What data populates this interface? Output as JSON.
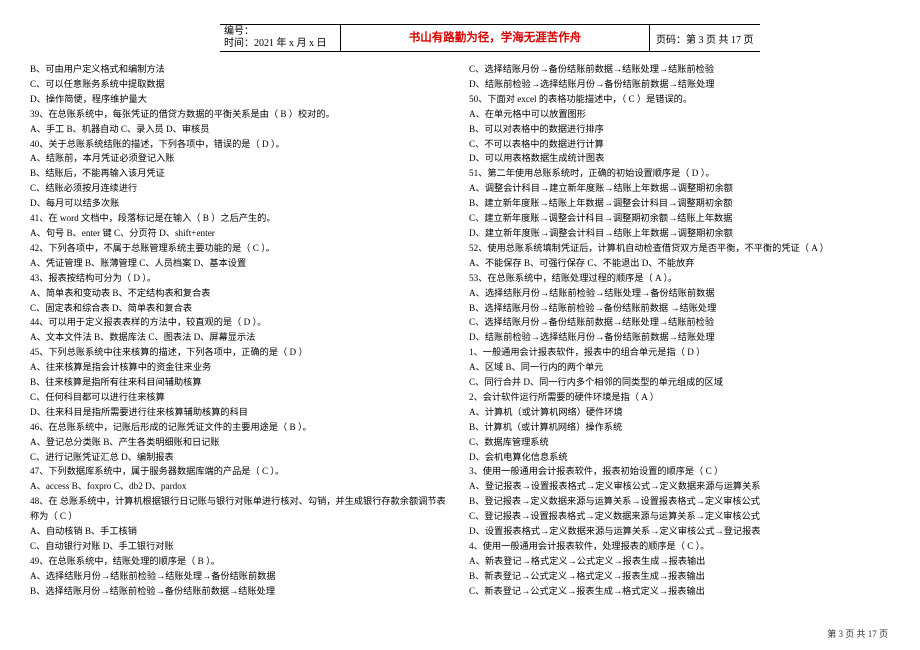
{
  "header": {
    "id_label": "编号：",
    "time_label": "时间：2021 年 x 月 x 日",
    "motto": "书山有路勤为径，学海无涯苦作舟",
    "page_label": "页码：第 3 页 共 17 页"
  },
  "footer": "第 3 页 共 17 页",
  "left_lines": [
    "B、可由用户定义格式和编制方法",
    "C、可以任意账务系统中提取数据",
    "D、操作简便，程序维护量大",
    "39、在总账系统中，每张凭证的借贷方数据的平衡关系是由（ B ）校对的。",
    "A、手工    B、机器自动    C、录入员    D、审核员",
    "40、关于总账系统结账的描述，下列各项中，错误的是（ D     ）。",
    "A、结账前，本月凭证必须登记入账",
    "B、结账后，不能再输入该月凭证",
    "C、结账必须按月连续进行",
    "D、每月可以结多次账",
    "41、在 word 文档中，段落标记是在输入（  B  ）之后产生的。",
    "A、句号    B、enter 键    C、分页符    D、shift+enter",
    "42、下列各项中，不属于总账管理系统主要功能的是（  C   ）。",
    "A、凭证管理   B、账薄管理    C、人员档案    D、基本设置",
    "43、报表按结构可分为（ D   ）。",
    "A、简单表和变动表    B、不定结构表和复合表",
    "C、固定表和综合表    D、简单表和复合表",
    "44、可以用于定义报表表样的方法中，较直观的是（ D ）。",
    "A、文本文件法    B、数据库法    C、图表法    D、屏幕显示法",
    "45、下列总账系统中往来核算的描述，下列各项中，正确的是（  D    ）",
    "A、往来核算是指会计核算中的资金往来业务",
    "B、往来核算是指所有往来科目间辅助核算",
    "C、任何科目都可以进行往来核算",
    "D、往来科目是指所需要进行往来核算辅助核算的科目",
    "46、在总账系统中，记账后形成的记账凭证文件的主要用途是（ B ）。",
    "A、登记总分类账    B、产生各类明细账和日记账",
    "C、进行记账凭证汇总 D、编制报表",
    "47、下列数据库系统中，属于服务器数据库端的产品是（  C    ）。",
    "A、access    B、foxpro    C、db2    D、pardox",
    "48、在 总账系统中，计算机根据银行日记账与银行对账单进行核对、勾销，并生成银行存款余额调节表",
    "称为（ C  ）",
    "A、自动核销       B、手工核销",
    "C、自动银行对账   D、手工银行对账",
    "49、在总账系统中，结账处理的顺序是（ B    ）。",
    "A、选择结账月份→结账前检验→结账处理→备份结账前数据",
    "B、选择结账月份→结账前检验→备份结账前数据→结账处理"
  ],
  "right_lines": [
    "C、选择结账月份→备份结账前数据→结账处理→结账前检验",
    "D、结账前检验→选择结账月份→备份结账前数据→结账处理",
    "50、下面对 excel 的表格功能描述中，（  C  ）是错误的。",
    "A、在单元格中可以放置图形",
    "B、可以对表格中的数据进行排序",
    "C、不可以表格中的数据进行计算",
    "D、可以用表格数据生成统计图表",
    "51、第二年使用总账系统时，正确的初始设置顺序是（ D    ）。",
    "A、调整会计科目→建立新年度账→结账上年数据→调整期初余额",
    "B、建立新年度账→结账上年数据→调整会计科目→调整期初余额",
    "C、建立新年度账→调整会计科目→调整期初余额→结账上年数据",
    "D、建立新年度账→调整会计科目→结账上年数据→调整期初余额",
    "52、使用总账系统填制凭证后，计算机自动检查借贷双方是否平衡，不平衡的凭证（ A ）",
    "A、不能保存    B、可强行保存    C、不能退出    D、不能放弃",
    "53、在总账系统中，结账处理过程的顺序是（ A  ）。",
    "A、选择结账月份→结账前检验→结账处理→备份结账前数据",
    "B、选择结账月份→结账前检验→备份结账前数据 →结账处理",
    "C、选择结账月份→备份结账前数据→结账处理→结账前检验",
    "D、结账前检验→选择结账月份→备份结账前数据→结账处理",
    "1、一般通用会计报表软件，报表中的组合单元是指（  D  ）",
    "A、区域        B、同一行内的两个单元",
    "C、同行合并    D、同一行内多个相邻的同类型的单元组成的区域",
    "2、会计软件运行所需要的硬件环境是指（   A  ）",
    "A、计算机（或计算机网络）硬件环境",
    "B、计算机（或计算机网络）操作系统",
    "C、数据库管理系统",
    "D、会机电算化信息系统",
    "3、使用一般通用会计报表软件，报表初始设置的顺序是（   C   ）",
    "A、登记报表→设置报表格式→定义审核公式→定义数据来源与运算关系",
    "B、登记报表→定义数据来源与运算关系→设置报表格式→定义审核公式",
    "C、登记报表→设置报表格式→定义数据来源与运算关系→定义审核公式",
    "D、设置报表格式→定义数据来源与运算关系→定义审核公式→登记报表",
    "4、使用一般通用会计报表软件，处理报表的顺序是（  C   ）。",
    "A、新表登记→格式定义→公式定义→报表生成→报表输出",
    "B、新表登记→公式定义→格式定义→报表生成→报表输出",
    "C、新表登记→公式定义→报表生成→格式定义→报表输出"
  ]
}
